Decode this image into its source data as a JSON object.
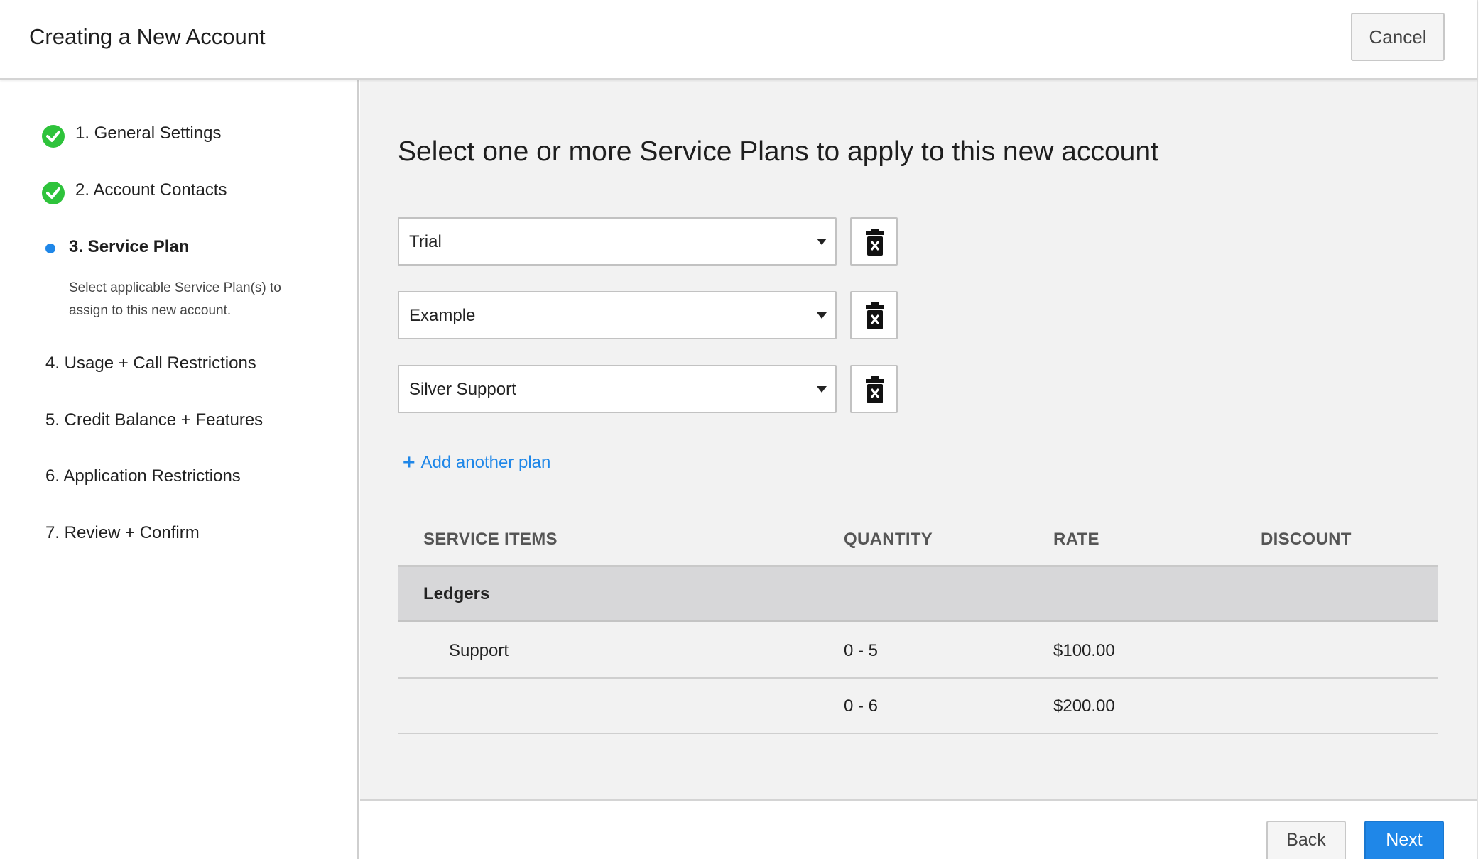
{
  "header": {
    "title": "Creating a New Account",
    "cancel_label": "Cancel"
  },
  "sidebar": {
    "steps": [
      {
        "label": "1. General Settings",
        "status": "complete",
        "icon": "check-circle-icon"
      },
      {
        "label": "2. Account Contacts",
        "status": "complete",
        "icon": "check-circle-icon"
      },
      {
        "label": "3. Service Plan",
        "status": "active",
        "icon": "dot-icon",
        "description": "Select applicable Service Plan(s) to assign to this new account."
      },
      {
        "label": "4. Usage + Call Restrictions",
        "status": "pending"
      },
      {
        "label": "5. Credit Balance + Features",
        "status": "pending"
      },
      {
        "label": "6. Application Restrictions",
        "status": "pending"
      },
      {
        "label": "7. Review + Confirm",
        "status": "pending"
      }
    ]
  },
  "main": {
    "heading": "Select one or more Service Plans to apply to this new account",
    "plans": [
      {
        "value": "Trial"
      },
      {
        "value": "Example"
      },
      {
        "value": "Silver Support"
      }
    ],
    "add_plan_label": "Add another plan",
    "table": {
      "columns": [
        "SERVICE ITEMS",
        "QUANTITY",
        "RATE",
        "DISCOUNT"
      ],
      "group": "Ledgers",
      "rows": [
        {
          "item": "Support",
          "quantity": "0 - 5",
          "rate": "$100.00",
          "discount": ""
        },
        {
          "item": "",
          "quantity": "0 - 6",
          "rate": "$200.00",
          "discount": ""
        }
      ]
    }
  },
  "footer": {
    "back_label": "Back",
    "next_label": "Next"
  },
  "colors": {
    "accent": "#1f87e8",
    "complete": "#2ec33b",
    "main_bg": "#f2f2f2",
    "group_row_bg": "#d7d7d9"
  }
}
